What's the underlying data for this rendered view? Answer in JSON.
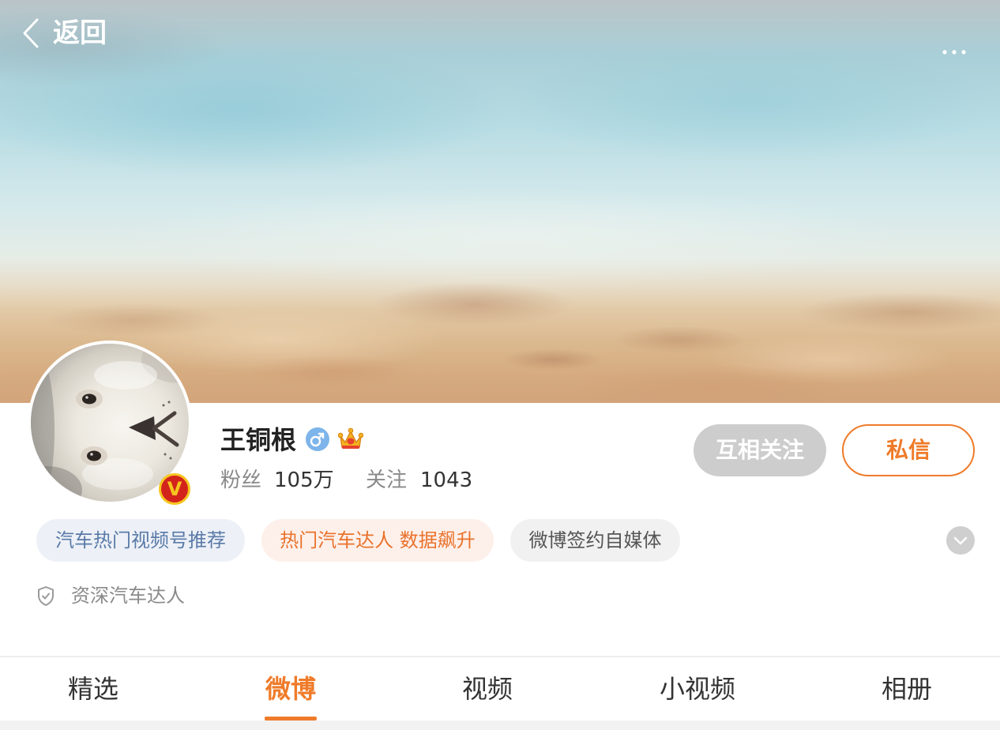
{
  "header": {
    "back_label": "返回",
    "back_icon": "chevron-left-icon",
    "more_icon": "more-dots-icon"
  },
  "profile": {
    "name": "王铜根",
    "gender_icon": "male-icon",
    "vip_icon": "crown-icon",
    "verified_badge": "V",
    "stats": {
      "followers_label": "粉丝",
      "followers_value": "105万",
      "following_label": "关注",
      "following_value": "1043"
    },
    "buttons": {
      "follow_label": "互相关注",
      "message_label": "私信"
    },
    "tags": [
      {
        "label": "汽车热门视频号推荐",
        "bg": "#edf1f7",
        "text_color": "#5a7aa8"
      },
      {
        "label": "热门汽车达人 数据飙升",
        "bg": "#fdf0ea",
        "text_color": "#e9722c"
      },
      {
        "label": "微博签约自媒体",
        "bg": "#f1f1f1",
        "text_color": "#555555"
      }
    ],
    "expand_icon": "chevron-down-icon",
    "verification_icon": "shield-check-icon",
    "verification": "资深汽车达人"
  },
  "tabs": [
    {
      "label": "精选",
      "active": false
    },
    {
      "label": "微博",
      "active": true
    },
    {
      "label": "视频",
      "active": false
    },
    {
      "label": "小视频",
      "active": false
    },
    {
      "label": "相册",
      "active": false
    }
  ],
  "colors": {
    "accent": "#ef7b2a",
    "text_primary": "#222222",
    "text_secondary": "#8a8a8a",
    "follow_button_bg": "#cdcdcd",
    "divider": "#eeeeee",
    "male_icon": "#7db4ea",
    "verified_badge": "#d3241c",
    "verified_badge_ring": "#f6c61f"
  }
}
